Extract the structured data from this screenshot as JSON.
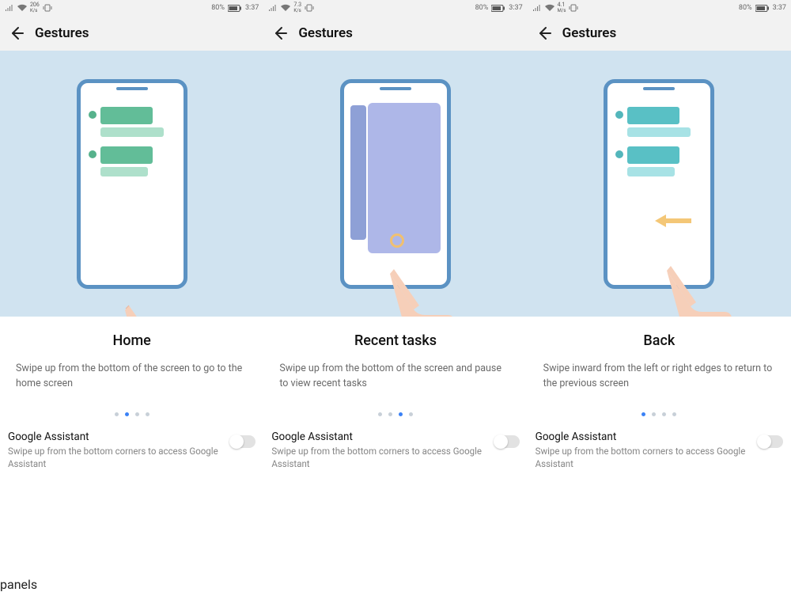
{
  "panels": [
    {
      "status": {
        "speed_value": "206",
        "speed_unit": "K/s",
        "battery": "80%",
        "time": "3:37"
      },
      "header": {
        "title": "Gestures"
      },
      "gesture": {
        "title": "Home",
        "desc": "Swipe up from the bottom of the screen to go to the home screen",
        "active_dot": 1,
        "total_dots": 4
      },
      "ga": {
        "title": "Google Assistant",
        "desc": "Swipe up from the bottom corners to access Google Assistant"
      }
    },
    {
      "status": {
        "speed_value": "7.3",
        "speed_unit": "K/s",
        "battery": "80%",
        "time": "3:37"
      },
      "header": {
        "title": "Gestures"
      },
      "gesture": {
        "title": "Recent tasks",
        "desc": "Swipe up from the bottom of the screen and pause to view recent tasks",
        "active_dot": 2,
        "total_dots": 4
      },
      "ga": {
        "title": "Google Assistant",
        "desc": "Swipe up from the bottom corners to access Google Assistant"
      }
    },
    {
      "status": {
        "speed_value": "4.1",
        "speed_unit": "M/s",
        "battery": "80%",
        "time": "3:37"
      },
      "header": {
        "title": "Gestures"
      },
      "gesture": {
        "title": "Back",
        "desc": "Swipe inward from the left or right edges to return to the previous screen",
        "active_dot": 0,
        "total_dots": 4
      },
      "ga": {
        "title": "Google Assistant",
        "desc": "Swipe up from the bottom corners to access Google Assistant"
      }
    }
  ]
}
